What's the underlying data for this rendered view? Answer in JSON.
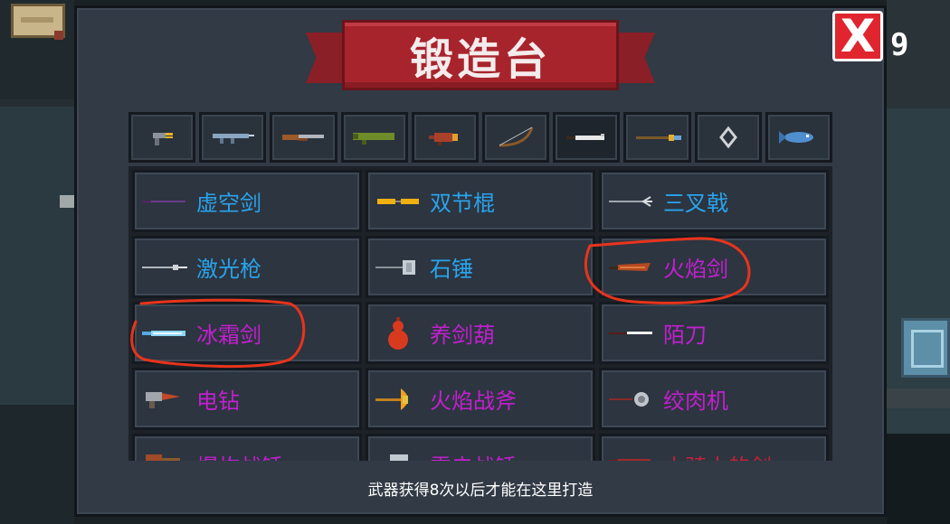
{
  "title": "锻造台",
  "close_button": {
    "label": "X"
  },
  "count": "9",
  "colors": {
    "panel": "#313a45",
    "banner": "#a8242d",
    "close": "#e0252f",
    "name_blue": "#2aa3ec",
    "name_purple": "#c41fd0",
    "name_red": "#c2213a",
    "annotation": "#e8341c"
  },
  "tabs": [
    {
      "icon": "pistol-icon",
      "active": false
    },
    {
      "icon": "rifle-icon",
      "active": false
    },
    {
      "icon": "shotgun-icon",
      "active": false
    },
    {
      "icon": "launcher-icon",
      "active": false
    },
    {
      "icon": "cannon-icon",
      "active": false
    },
    {
      "icon": "bow-icon",
      "active": false
    },
    {
      "icon": "sword-icon",
      "active": true
    },
    {
      "icon": "spear-icon",
      "active": false
    },
    {
      "icon": "shuriken-icon",
      "active": false
    },
    {
      "icon": "fish-icon",
      "active": false
    }
  ],
  "items": [
    {
      "name": "虚空剑",
      "color": "blue",
      "icon": "void-sword-icon"
    },
    {
      "name": "双节棍",
      "color": "blue",
      "icon": "nunchaku-icon"
    },
    {
      "name": "三叉戟",
      "color": "blue",
      "icon": "trident-icon"
    },
    {
      "name": "激光枪",
      "color": "blue",
      "icon": "laser-spear-icon"
    },
    {
      "name": "石锤",
      "color": "blue",
      "icon": "stone-hammer-icon"
    },
    {
      "name": "火焰剑",
      "color": "purple",
      "icon": "flame-sword-icon"
    },
    {
      "name": "冰霜剑",
      "color": "purple",
      "icon": "frost-sword-icon"
    },
    {
      "name": "养剑葫",
      "color": "purple",
      "icon": "gourd-icon"
    },
    {
      "name": "陌刀",
      "color": "purple",
      "icon": "modao-blade-icon"
    },
    {
      "name": "电钻",
      "color": "purple",
      "icon": "drill-icon"
    },
    {
      "name": "火焰战斧",
      "color": "purple",
      "icon": "flame-axe-icon"
    },
    {
      "name": "绞肉机",
      "color": "purple",
      "icon": "meat-grinder-icon"
    },
    {
      "name": "爆炸战锤",
      "color": "purple",
      "icon": "explosive-hammer-icon"
    },
    {
      "name": "雷电战锤",
      "color": "purple",
      "icon": "thunder-hammer-icon"
    },
    {
      "name": "小骑士的剑",
      "color": "red",
      "icon": "knight-sword-icon"
    }
  ],
  "hint": "武器获得8次以后才能在这里打造"
}
